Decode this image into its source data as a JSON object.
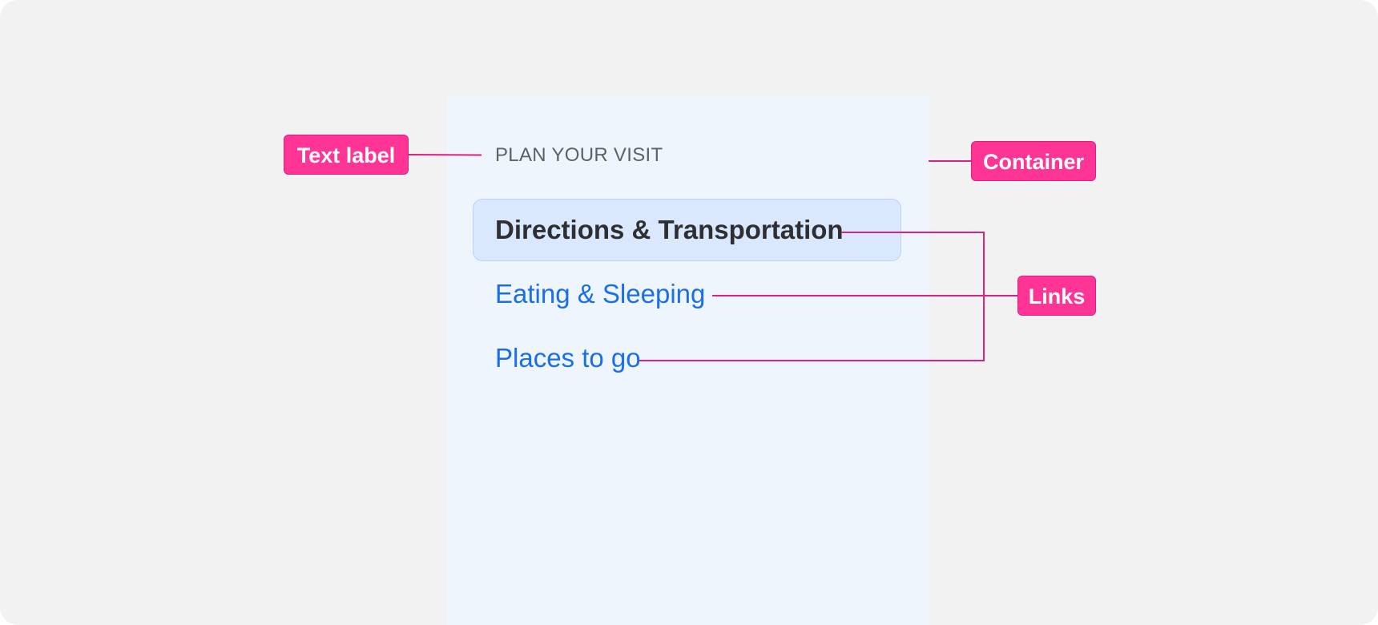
{
  "panel": {
    "heading": "PLAN YOUR VISIT",
    "links": [
      {
        "label": "Directions & Transportation",
        "active": true
      },
      {
        "label": "Eating & Sleeping",
        "active": false
      },
      {
        "label": "Places to go",
        "active": false
      }
    ]
  },
  "annotations": {
    "text_label": "Text label",
    "container": "Container",
    "links": "Links"
  },
  "colors": {
    "annotation": "#ff3596",
    "link": "#1a6fe8",
    "panel_background": "#eff5fd",
    "active_background": "#d9e8fd"
  }
}
